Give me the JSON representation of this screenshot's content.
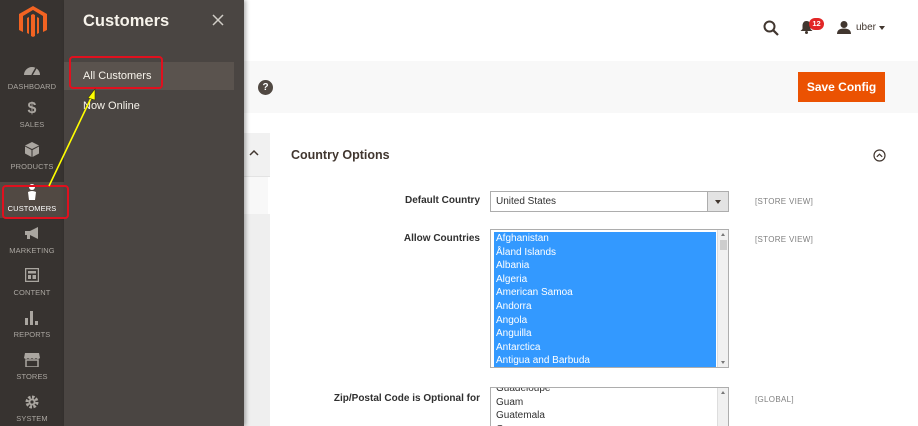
{
  "colors": {
    "nav_bg": "#373330",
    "flyout_bg": "#4a4542",
    "accent": "#eb5202",
    "selection": "#3399ff",
    "callout": "#e0101e",
    "arrow": "#ffff00"
  },
  "nav": {
    "logo": "magento-logo-icon",
    "items": [
      {
        "label": "DASHBOARD",
        "icon": "dashboard-icon"
      },
      {
        "label": "SALES",
        "icon": "dollar-icon"
      },
      {
        "label": "PRODUCTS",
        "icon": "cube-icon"
      },
      {
        "label": "CUSTOMERS",
        "icon": "person-icon",
        "active": true
      },
      {
        "label": "MARKETING",
        "icon": "megaphone-icon"
      },
      {
        "label": "CONTENT",
        "icon": "layout-icon"
      },
      {
        "label": "REPORTS",
        "icon": "bar-chart-icon"
      },
      {
        "label": "STORES",
        "icon": "storefront-icon"
      },
      {
        "label": "SYSTEM",
        "icon": "gear-icon"
      }
    ]
  },
  "flyout": {
    "title": "Customers",
    "items": [
      {
        "label": "All Customers"
      },
      {
        "label": "Now Online"
      }
    ]
  },
  "header": {
    "notification_count": "12",
    "user_name": "uber"
  },
  "action_bar": {
    "help": "?",
    "save_label": "Save Config"
  },
  "section": {
    "title": "Country Options",
    "default_country": {
      "label": "Default Country",
      "value": "United States",
      "scope": "[STORE VIEW]"
    },
    "allow_countries": {
      "label": "Allow Countries",
      "scope": "[STORE VIEW]",
      "options": [
        "Afghanistan",
        "Åland Islands",
        "Albania",
        "Algeria",
        "American Samoa",
        "Andorra",
        "Angola",
        "Anguilla",
        "Antarctica",
        "Antigua and Barbuda"
      ]
    },
    "zip_optional": {
      "label": "Zip/Postal Code is Optional for",
      "scope": "[GLOBAL]",
      "options": [
        "Guadeloupe",
        "Guam",
        "Guatemala",
        "Guernsey"
      ]
    }
  }
}
